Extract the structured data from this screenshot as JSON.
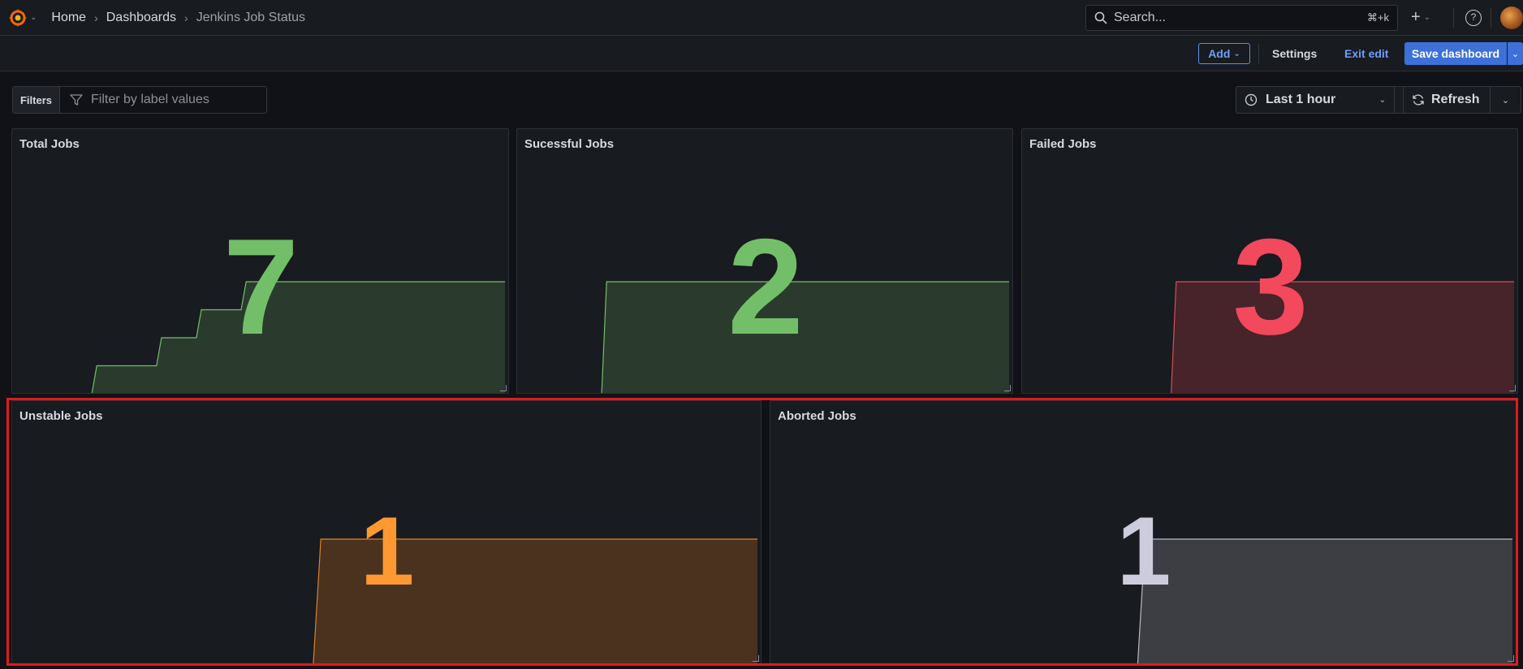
{
  "topbar": {
    "breadcrumbs": [
      "Home",
      "Dashboards",
      "Jenkins Job Status"
    ],
    "breadcrumb_separator": "›",
    "search_placeholder": "Search...",
    "search_shortcut": "⌘+k",
    "plus_label": "+",
    "help_label": "?"
  },
  "editbar": {
    "add_label": "Add",
    "settings_label": "Settings",
    "exit_edit_label": "Exit edit",
    "save_label": "Save dashboard"
  },
  "controls": {
    "filters_label": "Filters",
    "filters_placeholder": "Filter by label values",
    "time_range": "Last 1 hour",
    "refresh_label": "Refresh"
  },
  "colors": {
    "green": "#73bf69",
    "red": "#f2495c",
    "orange": "#ff9830",
    "gray": "#ccccdc",
    "accent_blue": "#3d71d9"
  },
  "panels": [
    {
      "title": "Total Jobs",
      "value": "7",
      "color": "green",
      "series": [
        0,
        0,
        0,
        0,
        0,
        0,
        0,
        0,
        0,
        0,
        0,
        0,
        0,
        0,
        0,
        0,
        0,
        1,
        1,
        1,
        1,
        1,
        1,
        1,
        1,
        1,
        1,
        1,
        1,
        1,
        2,
        2,
        2,
        2,
        2,
        2,
        2,
        2,
        3,
        3,
        3,
        3,
        3,
        3,
        3,
        3,
        3,
        4,
        4,
        4,
        4,
        4,
        4,
        4,
        4,
        4,
        4,
        4,
        4,
        4,
        4,
        4,
        4,
        4,
        4,
        4,
        4,
        4,
        4,
        4,
        4,
        4,
        4,
        4,
        4,
        4,
        4,
        4,
        4,
        4,
        4,
        4,
        4,
        4,
        4,
        4,
        4,
        4,
        4,
        4,
        4,
        4,
        4,
        4,
        4,
        4,
        4,
        4,
        4,
        4
      ]
    },
    {
      "title": "Sucessful Jobs",
      "value": "2",
      "color": "green",
      "series": [
        0,
        0,
        0,
        0,
        0,
        0,
        0,
        0,
        0,
        0,
        0,
        0,
        0,
        0,
        0,
        0,
        0,
        0,
        1,
        1,
        1,
        1,
        1,
        1,
        1,
        1,
        1,
        1,
        1,
        1,
        1,
        1,
        1,
        1,
        1,
        1,
        1,
        1,
        1,
        1,
        1,
        1,
        1,
        1,
        1,
        1,
        1,
        1,
        1,
        1,
        1,
        1,
        1,
        1,
        1,
        1,
        1,
        1,
        1,
        1,
        1,
        1,
        1,
        1,
        1,
        1,
        1,
        1,
        1,
        1,
        1,
        1,
        1,
        1,
        1,
        1,
        1,
        1,
        1,
        1,
        1,
        1,
        1,
        1,
        1,
        1,
        1,
        1,
        1,
        1,
        1,
        1,
        1,
        1,
        1,
        1,
        1,
        1,
        1,
        1
      ]
    },
    {
      "title": "Failed Jobs",
      "value": "3",
      "color": "red",
      "series": [
        0,
        0,
        0,
        0,
        0,
        0,
        0,
        0,
        0,
        0,
        0,
        0,
        0,
        0,
        0,
        0,
        0,
        0,
        0,
        0,
        0,
        0,
        0,
        0,
        0,
        0,
        0,
        0,
        0,
        0,
        0,
        1,
        1,
        1,
        1,
        1,
        1,
        1,
        1,
        1,
        1,
        1,
        1,
        1,
        1,
        1,
        1,
        1,
        1,
        1,
        1,
        1,
        1,
        1,
        1,
        1,
        1,
        1,
        1,
        1,
        1,
        1,
        1,
        1,
        1,
        1,
        1,
        1,
        1,
        1,
        1,
        1,
        1,
        1,
        1,
        1,
        1,
        1,
        1,
        1,
        1,
        1,
        1,
        1,
        1,
        1,
        1,
        1,
        1,
        1,
        1,
        1,
        1,
        1,
        1,
        1,
        1,
        1,
        1,
        1
      ]
    },
    {
      "title": "Unstable Jobs",
      "value": "1",
      "color": "orange",
      "series": [
        0,
        0,
        0,
        0,
        0,
        0,
        0,
        0,
        0,
        0,
        0,
        0,
        0,
        0,
        0,
        0,
        0,
        0,
        0,
        0,
        0,
        0,
        0,
        0,
        0,
        0,
        0,
        0,
        0,
        0,
        0,
        0,
        0,
        0,
        0,
        0,
        0,
        0,
        0,
        0,
        0,
        1,
        1,
        1,
        1,
        1,
        1,
        1,
        1,
        1,
        1,
        1,
        1,
        1,
        1,
        1,
        1,
        1,
        1,
        1,
        1,
        1,
        1,
        1,
        1,
        1,
        1,
        1,
        1,
        1,
        1,
        1,
        1,
        1,
        1,
        1,
        1,
        1,
        1,
        1,
        1,
        1,
        1,
        1,
        1,
        1,
        1,
        1,
        1,
        1,
        1,
        1,
        1,
        1,
        1,
        1,
        1,
        1,
        1,
        1
      ]
    },
    {
      "title": "Aborted Jobs",
      "value": "1",
      "color": "gray",
      "series": [
        0,
        0,
        0,
        0,
        0,
        0,
        0,
        0,
        0,
        0,
        0,
        0,
        0,
        0,
        0,
        0,
        0,
        0,
        0,
        0,
        0,
        0,
        0,
        0,
        0,
        0,
        0,
        0,
        0,
        0,
        0,
        0,
        0,
        0,
        0,
        0,
        0,
        0,
        0,
        0,
        0,
        0,
        0,
        0,
        0,
        0,
        0,
        0,
        0,
        0,
        1,
        1,
        1,
        1,
        1,
        1,
        1,
        1,
        1,
        1,
        1,
        1,
        1,
        1,
        1,
        1,
        1,
        1,
        1,
        1,
        1,
        1,
        1,
        1,
        1,
        1,
        1,
        1,
        1,
        1,
        1,
        1,
        1,
        1,
        1,
        1,
        1,
        1,
        1,
        1,
        1,
        1,
        1,
        1,
        1,
        1,
        1,
        1,
        1,
        1
      ]
    }
  ]
}
